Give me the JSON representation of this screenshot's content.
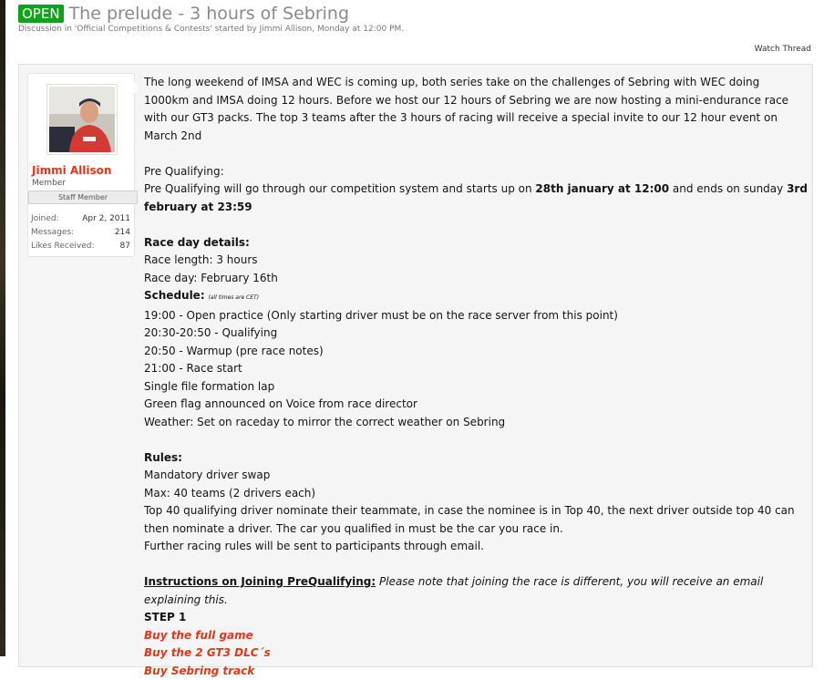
{
  "thread": {
    "badge": "OPEN",
    "title": "The prelude - 3 hours of Sebring",
    "description": "Discussion in 'Official Competitions & Contests' started by Jimmi Allison, Monday at 12:00 PM.",
    "watch_label": "Watch Thread"
  },
  "author": {
    "name": "Jimmi Allison",
    "title": "Member",
    "staff_label": "Staff Member",
    "stats": [
      {
        "label": "Joined:",
        "value": "Apr 2, 2011"
      },
      {
        "label": "Messages:",
        "value": "214"
      },
      {
        "label": "Likes Received:",
        "value": "87"
      }
    ]
  },
  "post": {
    "intro": "The long weekend of IMSA and WEC is coming up, both series take on the challenges of Sebring with WEC doing 1000km and IMSA doing 12 hours. Before we host our 12 hours of Sebring we are now hosting a mini-endurance race with our GT3 packs. The top 3 teams after the 3 hours of racing will receive a special invite to our 12 hour event on March 2nd",
    "prequal_heading": "Pre Qualifying:",
    "prequal_text_1": "Pre Qualifying will go through our competition system and starts up on ",
    "prequal_start": "28th january at 12:00",
    "prequal_text_2": " and ends on sunday ",
    "prequal_end": "3rd february at 23:59",
    "raceday_heading": "Race day details:",
    "race_length": "Race length: 3 hours",
    "race_day": "Race day: February 16th",
    "schedule_label": "Schedule:",
    "schedule_note": "(all times are CET)",
    "schedule": [
      "19:00 - Open practice (Only starting driver must be on the race server from this point)",
      "20:30-20:50 - Qualifying",
      "20:50 - Warmup (pre race notes)",
      "21:00 - Race start",
      "Single file formation lap",
      "Green flag announced on Voice from race director",
      "Weather: Set on raceday to mirror the correct weather on Sebring"
    ],
    "rules_heading": "Rules:",
    "rules": [
      "Mandatory driver swap",
      "Max: 40 teams (2 drivers each)",
      "Top 40 qualifying driver nominate their teammate, in case the nominee is in Top 40, the next driver outside top 40 can then nominate a driver. The car you qualified in must be the car you race in.",
      "Further racing rules will be sent to participants through email."
    ],
    "instructions_heading": "Instructions on Joining PreQualifying:",
    "instructions_note": " Please note that joining the race is different, you will receive an email explaining this.",
    "step_label": "STEP 1",
    "links": [
      "Buy the full game",
      "Buy the 2 GT3 DLC´s",
      "Buy Sebring track"
    ]
  },
  "colors": {
    "badge": "#12a21a",
    "author_name": "#e0381a",
    "links": "#e0381a"
  }
}
